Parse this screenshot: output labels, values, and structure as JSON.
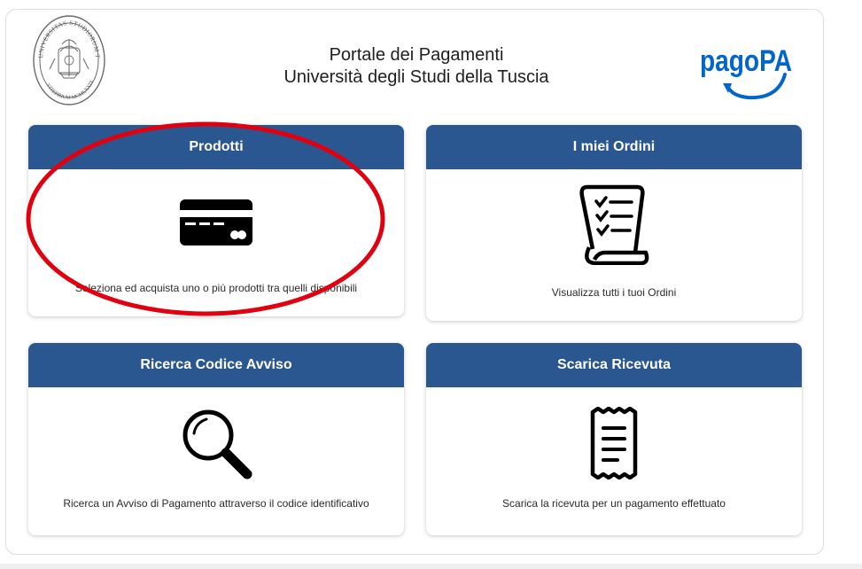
{
  "header": {
    "title_line1": "Portale dei Pagamenti",
    "title_line2": "Università degli Studi della Tuscia",
    "logo_text": "pagoPA",
    "seal_text_top": "UNIVERSITAS STUDIORUM TUSCIAE",
    "seal_text_bottom": "VITERBIUM MCMLXXIX",
    "seal_icon": "university-seal-icon"
  },
  "colors": {
    "card_header": "#2b5791",
    "pagopa_blue": "#0066cc",
    "highlight": "#e0000f"
  },
  "cards": [
    {
      "title": "Prodotti",
      "description": "Seleziona ed acquista uno o più prodotti tra quelli disponibili",
      "icon": "credit-card-icon"
    },
    {
      "title": "I miei Ordini",
      "description": "Visualizza tutti i tuoi Ordini",
      "icon": "checklist-scroll-icon"
    },
    {
      "title": "Ricerca Codice Avviso",
      "description": "Ricerca un Avviso di Pagamento attraverso il codice identificativo",
      "icon": "magnifier-icon"
    },
    {
      "title": "Scarica Ricevuta",
      "description": "Scarica la ricevuta per un pagamento effettuato",
      "icon": "receipt-icon"
    }
  ]
}
